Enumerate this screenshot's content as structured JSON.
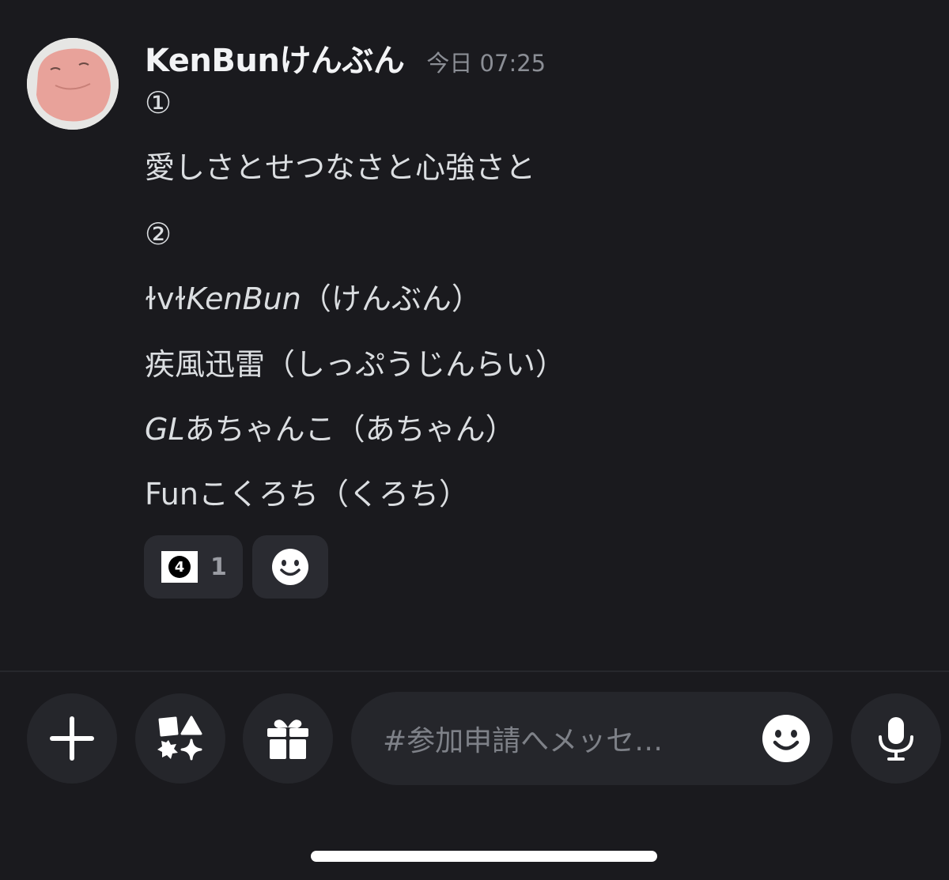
{
  "message": {
    "username": "KenBunけんぶん",
    "timestamp": "今日 07:25",
    "lines": {
      "l1": "①",
      "l2": "愛しさとせつなさと心強さと",
      "l3": "②",
      "l4_prefix": "ɫvɫ",
      "l4_italic": "KenBun",
      "l4_suffix": "（けんぶん）",
      "l5": "疾風迅雷（しっぷうじんらい）",
      "l6_italic": "GL",
      "l6_suffix": "あちゃんこ（あちゃん）",
      "l7": "Funこくろち（くろち）"
    },
    "reactions": [
      {
        "emoji": "4",
        "count": "1"
      }
    ]
  },
  "input": {
    "placeholder": "#参加申請へメッセ…"
  },
  "icons": {
    "plus": "plus-icon",
    "apps": "apps-icon",
    "gift": "gift-icon",
    "emoji": "emoji-smile-icon",
    "mic": "microphone-icon"
  },
  "colors": {
    "background": "#1a1a1e",
    "surface": "#25262b",
    "text": "#dbdee1",
    "muted": "#8b8e95"
  }
}
